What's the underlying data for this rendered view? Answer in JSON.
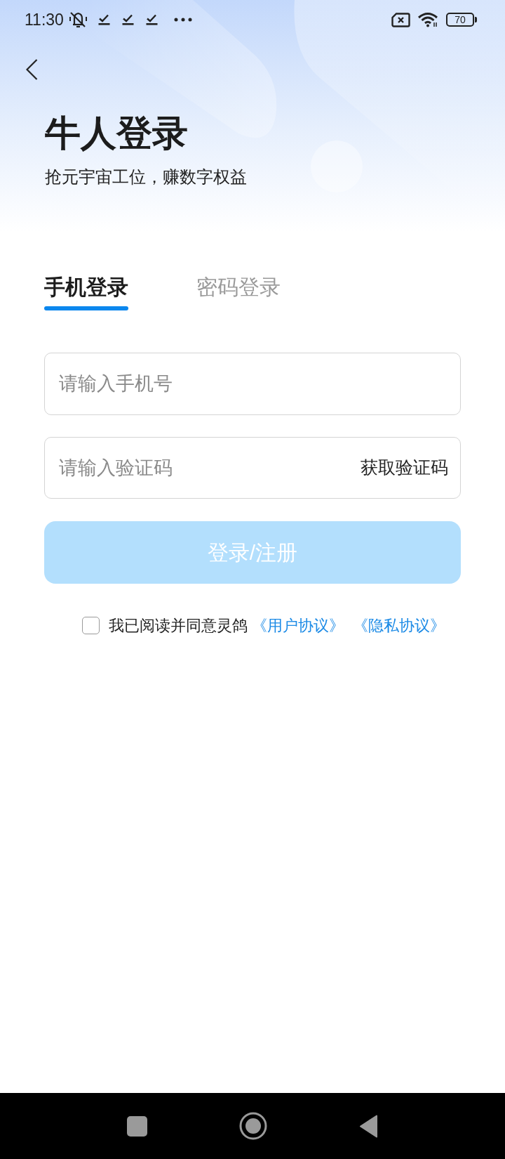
{
  "status_bar": {
    "time": "11:30",
    "battery": "70"
  },
  "header": {
    "title": "牛人登录",
    "subtitle": "抢元宇宙工位，赚数字权益"
  },
  "tabs": [
    {
      "label": "手机登录",
      "selected": true
    },
    {
      "label": "密码登录",
      "selected": false
    }
  ],
  "form": {
    "phone_field": {
      "placeholder": "请输入手机号"
    },
    "code_field": {
      "placeholder": "请输入验证码",
      "action": "获取验证码"
    },
    "submit": {
      "label": "登录/注册",
      "disabled": true
    }
  },
  "agreement": {
    "checked": false,
    "text": "我已阅读并同意灵鸽",
    "links": [
      "《用户协议》",
      "《隐私协议》"
    ]
  }
}
